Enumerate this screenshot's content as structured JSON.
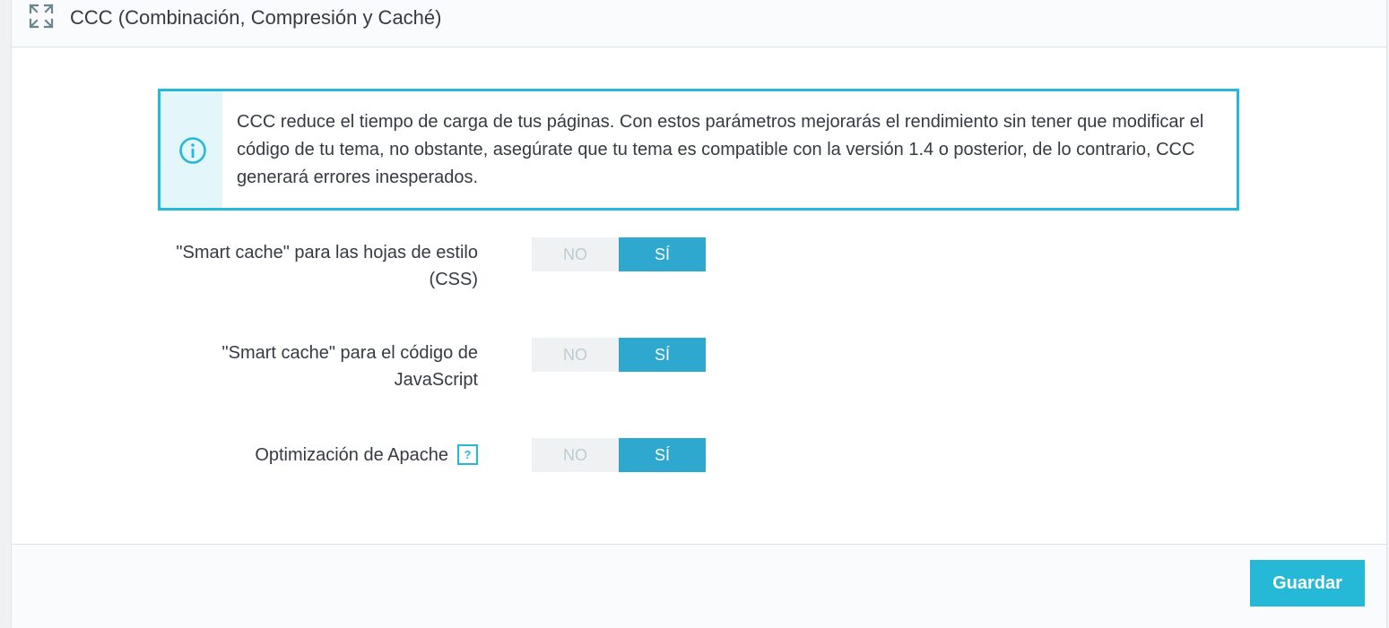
{
  "panel": {
    "title": "CCC (Combinación, Compresión y Caché)",
    "heading_icon": "expand-arrows-icon"
  },
  "alert": {
    "icon": "info-circle-icon",
    "text": "CCC reduce el tiempo de carga de tus páginas. Con estos parámetros mejorarás el rendimiento sin tener que modificar el código de tu tema, no obstante, asegúrate que tu tema es compatible con la versión 1.4 o posterior, de lo contrario, CCC generará errores inesperados."
  },
  "settings": [
    {
      "label": "\"Smart cache\" para las hojas de estilo (CSS)",
      "off_label": "NO",
      "on_label": "SÍ",
      "selected": "SÍ"
    },
    {
      "label": "\"Smart cache\" para el código de JavaScript",
      "off_label": "NO",
      "on_label": "SÍ",
      "selected": "SÍ"
    },
    {
      "label": "Optimización de Apache",
      "help": "?",
      "off_label": "NO",
      "on_label": "SÍ",
      "selected": "SÍ"
    }
  ],
  "footer": {
    "save_label": "Guardar"
  },
  "colors": {
    "accent": "#25b9d7",
    "switch_active": "#2ea8cf",
    "switch_inactive": "#eff1f2",
    "text": "#363a41"
  }
}
